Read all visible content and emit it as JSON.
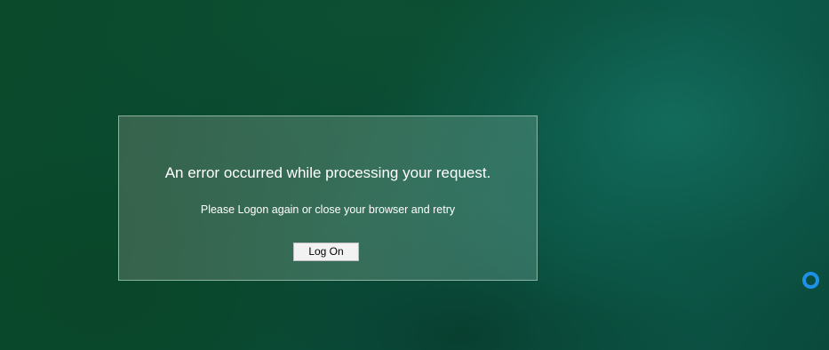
{
  "dialog": {
    "title": "An error occurred while processing your request.",
    "message": "Please Logon again or close your browser and retry",
    "button_label": "Log On"
  },
  "indicator": {
    "icon": "loading-ring-icon",
    "color": "#1e90e6"
  },
  "colors": {
    "background": "#0b4a33",
    "dialog_border": "#aacdbe",
    "button_background": "#f2f2f2"
  }
}
